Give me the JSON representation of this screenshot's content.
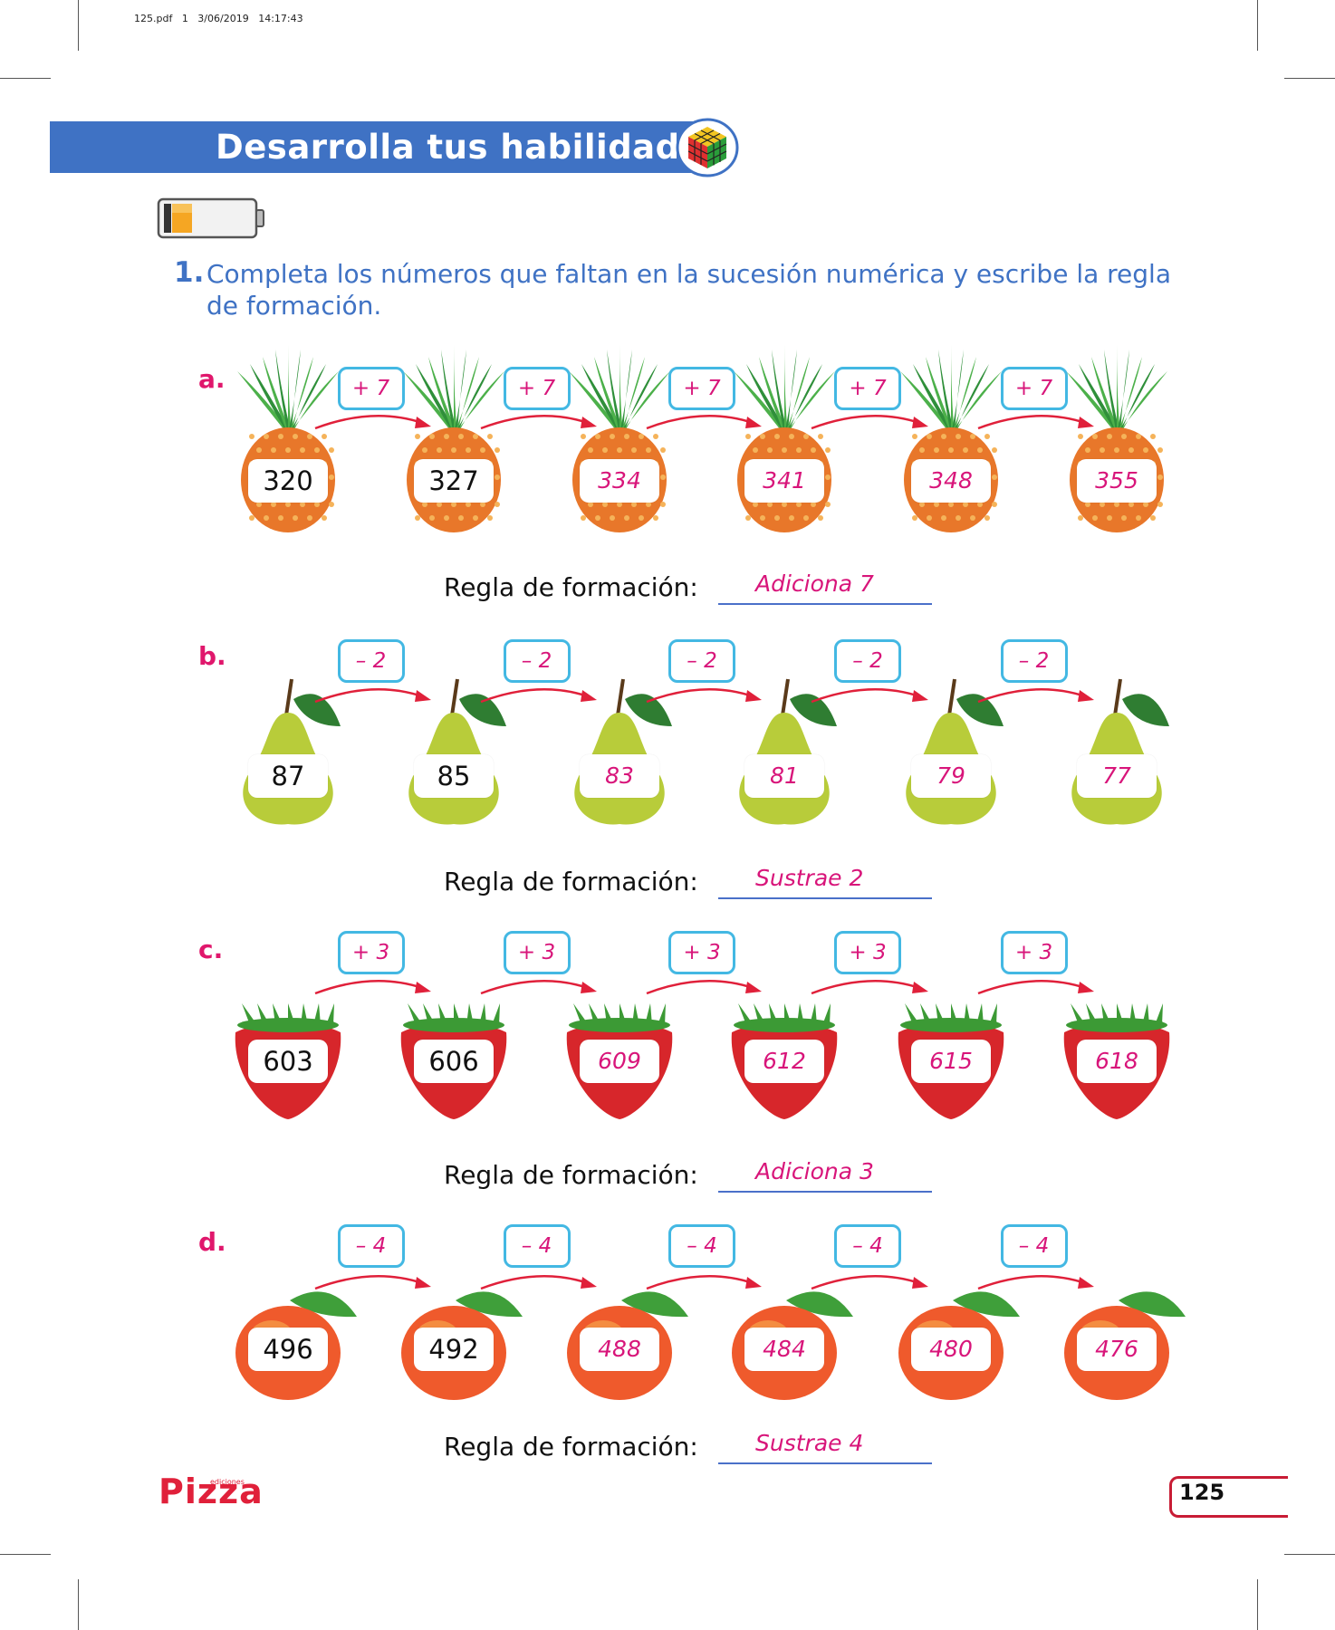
{
  "pdf_meta": "125.pdf   1   3/06/2019   14:17:43",
  "header": {
    "title": "Desarrolla tus habilidades"
  },
  "instruction": {
    "number": "1.",
    "text": "Completa los números que faltan en la sucesión numérica y escribe la regla de formación."
  },
  "rule_label": "Regla de formación:",
  "exercises": [
    {
      "letter": "a.",
      "fruit": "pineapple",
      "ops": [
        "+ 7",
        "+ 7",
        "+ 7",
        "+ 7",
        "+ 7"
      ],
      "numbers": [
        "320",
        "327",
        "334",
        "341",
        "348",
        "355"
      ],
      "answered": [
        false,
        false,
        true,
        true,
        true,
        true
      ],
      "rule_answer": "Adiciona 7"
    },
    {
      "letter": "b.",
      "fruit": "pear",
      "ops": [
        "– 2",
        "– 2",
        "– 2",
        "– 2",
        "– 2"
      ],
      "numbers": [
        "87",
        "85",
        "83",
        "81",
        "79",
        "77"
      ],
      "answered": [
        false,
        false,
        true,
        true,
        true,
        true
      ],
      "rule_answer": "Sustrae 2"
    },
    {
      "letter": "c.",
      "fruit": "strawberry",
      "ops": [
        "+ 3",
        "+ 3",
        "+ 3",
        "+ 3",
        "+ 3"
      ],
      "numbers": [
        "603",
        "606",
        "609",
        "612",
        "615",
        "618"
      ],
      "answered": [
        false,
        false,
        true,
        true,
        true,
        true
      ],
      "rule_answer": "Adiciona 3"
    },
    {
      "letter": "d.",
      "fruit": "peach",
      "ops": [
        "– 4",
        "– 4",
        "– 4",
        "– 4",
        "– 4"
      ],
      "numbers": [
        "496",
        "492",
        "488",
        "484",
        "480",
        "476"
      ],
      "answered": [
        false,
        false,
        true,
        true,
        true,
        true
      ],
      "rule_answer": "Sustrae 4"
    }
  ],
  "footer": {
    "logo": "Pizza",
    "logo_small": "ediciones",
    "page_number": "125"
  },
  "colors": {
    "header_blue": "#3f72c4",
    "answer_magenta": "#d8157a",
    "op_border": "#43b8e3",
    "arrow_red": "#e0203a",
    "letter_pink": "#e0176c"
  },
  "icons": [
    "rubiks-cube-icon",
    "battery-icon"
  ]
}
